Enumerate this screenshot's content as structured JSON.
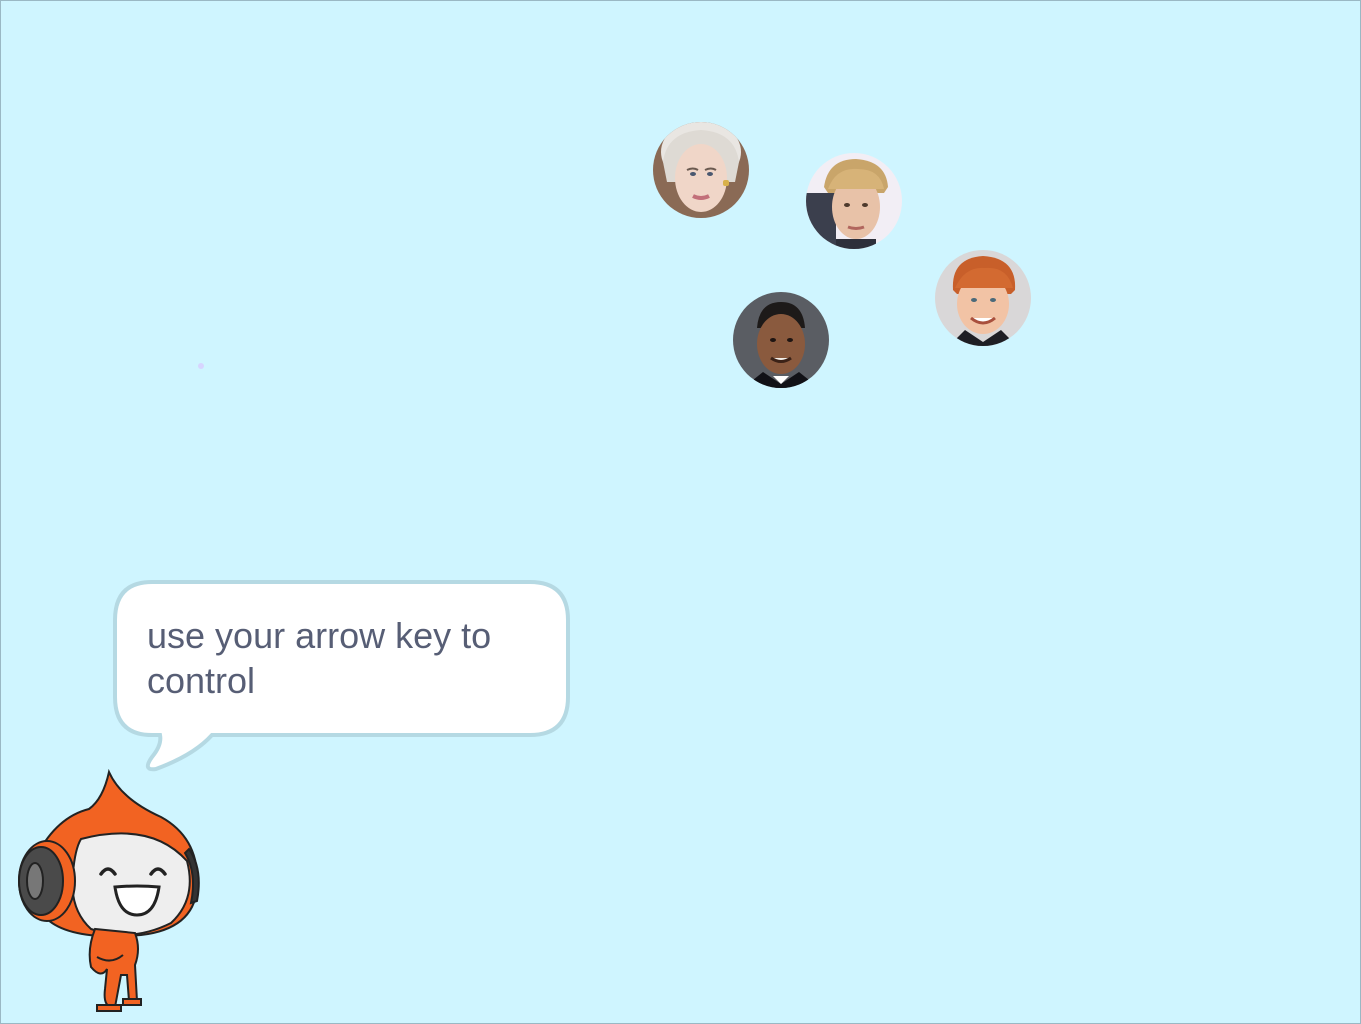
{
  "stage": {
    "background_color": "#cff5ff"
  },
  "speech_bubble": {
    "text": "use your arrow key to control"
  },
  "sprites": [
    {
      "name": "face-avatar-platinum-hair",
      "icon": "portrait-icon"
    },
    {
      "name": "face-avatar-blonde-hair",
      "icon": "portrait-icon"
    },
    {
      "name": "face-avatar-ginger-hair",
      "icon": "portrait-icon"
    },
    {
      "name": "face-avatar-dark-hair",
      "icon": "portrait-icon"
    }
  ],
  "player": {
    "icon": "orange-mascot-with-headphones"
  }
}
